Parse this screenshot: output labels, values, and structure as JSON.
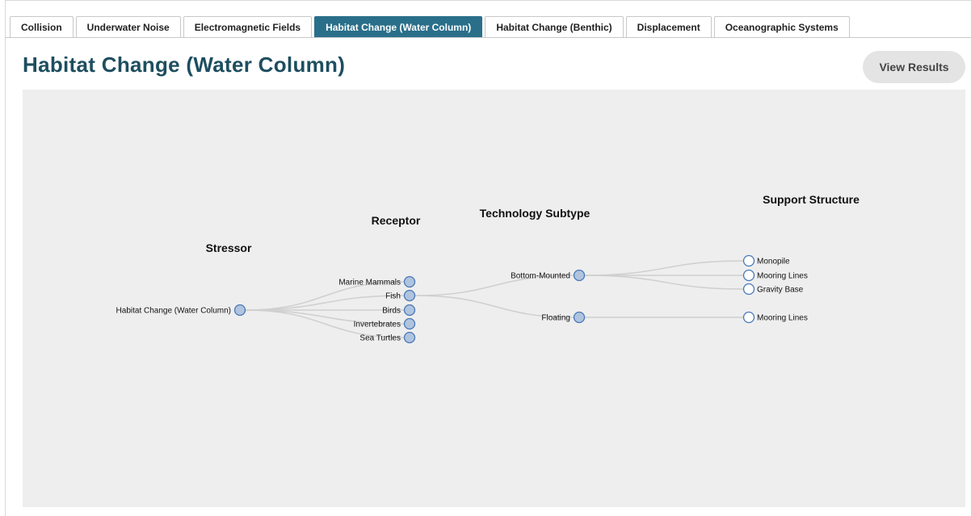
{
  "tabs": [
    {
      "label": "Collision"
    },
    {
      "label": "Underwater Noise"
    },
    {
      "label": "Electromagnetic Fields"
    },
    {
      "label": "Habitat Change (Water Column)",
      "active": true
    },
    {
      "label": "Habitat Change (Benthic)"
    },
    {
      "label": "Displacement"
    },
    {
      "label": "Oceanographic Systems"
    }
  ],
  "page": {
    "title": "Habitat Change (Water Column)",
    "view_results_label": "View Results"
  },
  "tree": {
    "columns": {
      "stressor": "Stressor",
      "receptor": "Receptor",
      "technology_subtype": "Technology Subtype",
      "support_structure": "Support Structure"
    },
    "stressor": "Habitat Change (Water Column)",
    "receptors": [
      "Marine Mammals",
      "Fish",
      "Birds",
      "Invertebrates",
      "Sea Turtles"
    ],
    "expanded_receptor": "Fish",
    "technology_subtypes": [
      {
        "label": "Bottom-Mounted",
        "support_structures": [
          "Monopile",
          "Mooring Lines",
          "Gravity Base"
        ]
      },
      {
        "label": "Floating",
        "support_structures": [
          "Mooring Lines"
        ]
      }
    ]
  },
  "colors": {
    "accent": "#2a6f8a",
    "title": "#1d4e5f",
    "node_fill": "#b0c4de",
    "node_stroke": "#4a78b8",
    "link": "#cfcfcf"
  }
}
